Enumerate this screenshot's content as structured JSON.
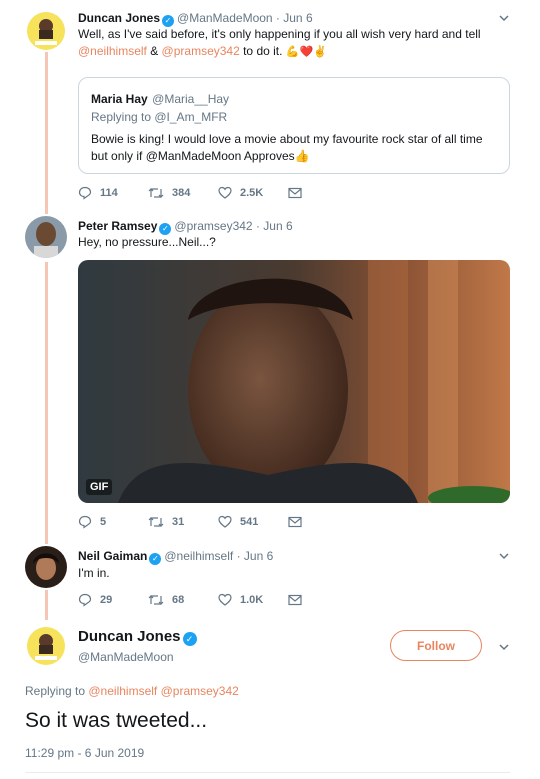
{
  "tweet1": {
    "name": "Duncan Jones",
    "handle": "@ManMadeMoon · Jun 6",
    "text_line1": "Well, as I've said before, it's only happening if you all wish very hard and tell",
    "mention_a": "@neilhimself",
    "amp": " & ",
    "mention_b": "@pramsey342",
    "text_tail": " to do it.",
    "emojis": "💪❤️✌️",
    "quote": {
      "name": "Maria Hay",
      "handle": "@Maria__Hay",
      "replying": "Replying to @I_Am_MFR",
      "text": "Bowie is king! I would love a movie about my favourite rock star of all time but only if @ManMadeMoon Approves👍"
    },
    "actions": {
      "replies": "114",
      "retweets": "384",
      "likes": "2.5K"
    }
  },
  "tweet2": {
    "name": "Peter Ramsey",
    "handle": "@pramsey342 · Jun 6",
    "text": "Hey, no pressure...Neil...?",
    "gif_label": "GIF",
    "actions": {
      "replies": "5",
      "retweets": "31",
      "likes": "541"
    }
  },
  "tweet3": {
    "name": "Neil Gaiman",
    "handle": "@neilhimself · Jun 6",
    "text": "I'm in.",
    "actions": {
      "replies": "29",
      "retweets": "68",
      "likes": "1.0K"
    }
  },
  "main": {
    "name": "Duncan Jones",
    "handle": "@ManMadeMoon",
    "follow_label": "Follow",
    "replying_prefix": "Replying to ",
    "replying_a": "@neilhimself",
    "replying_b": "@pramsey342",
    "text": "So it was tweeted...",
    "timestamp": "11:29 pm - 6 Jun 2019"
  },
  "colors": {
    "accent": "#e8855f",
    "verified": "#1da1f2",
    "muted": "#657786"
  }
}
